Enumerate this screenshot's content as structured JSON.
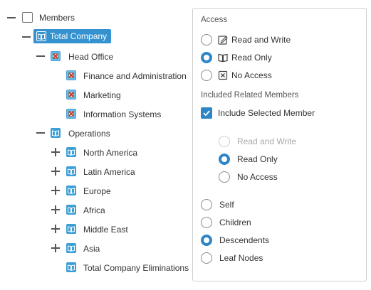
{
  "tree": {
    "root_label": "Members",
    "total_company": "Total Company",
    "head_office": "Head Office",
    "head_office_children": [
      "Finance and Administration",
      "Marketing",
      "Information Systems"
    ],
    "operations": "Operations",
    "operations_children": [
      "North America",
      "Latin America",
      "Europe",
      "Africa",
      "Middle East",
      "Asia"
    ],
    "eliminations": "Total Company Eliminations"
  },
  "access": {
    "title": "Access",
    "options": [
      {
        "label": "Read and Write",
        "icon": "pencil-square-icon",
        "selected": false
      },
      {
        "label": "Read Only",
        "icon": "book-icon",
        "selected": true
      },
      {
        "label": "No Access",
        "icon": "x-square-icon",
        "selected": false
      }
    ]
  },
  "related": {
    "title": "Included Related Members",
    "include_selected_label": "Include Selected Member",
    "include_selected_checked": true,
    "selected_access": [
      {
        "label": "Read and Write",
        "selected": false,
        "disabled": true
      },
      {
        "label": "Read Only",
        "selected": true,
        "disabled": false
      },
      {
        "label": "No Access",
        "selected": false,
        "disabled": false
      }
    ],
    "relations": [
      {
        "label": "Self",
        "selected": false
      },
      {
        "label": "Children",
        "selected": false
      },
      {
        "label": "Descendents",
        "selected": true
      },
      {
        "label": "Leaf Nodes",
        "selected": false
      }
    ]
  },
  "colors": {
    "accent": "#2f86c6",
    "highlight": "#3592d0",
    "member_icon": "#3d9fd6"
  }
}
